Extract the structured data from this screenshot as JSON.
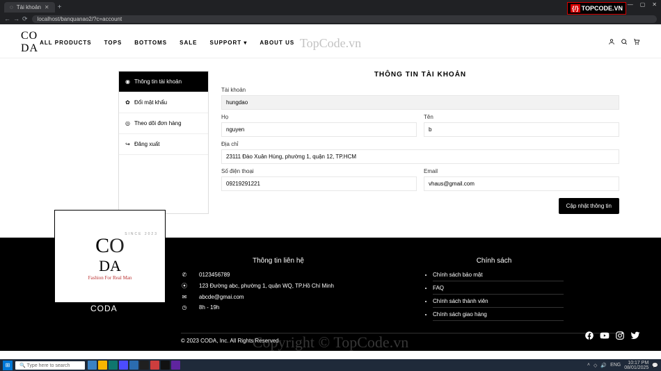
{
  "browser": {
    "tab_title": "Tài khoản",
    "url": "localhost/banquanao2/?c=account",
    "win_min": "—",
    "win_max": "▢",
    "win_close": "✕"
  },
  "watermarks": {
    "topcode": "TOPCODE.VN",
    "center": "TopCode.vn",
    "footer_wm": "Copyright © TopCode.vn"
  },
  "header": {
    "logo": "CODA",
    "nav": {
      "all": "ALL PRODUCTS",
      "tops": "TOPS",
      "bottoms": "BOTTOMS",
      "sale": "SALE",
      "support": "SUPPORT",
      "about": "ABOUT US"
    }
  },
  "sidebar": {
    "account_info": "Thông tin tài khoản",
    "change_pw": "Đổi mật khẩu",
    "orders": "Theo dõi đơn hàng",
    "logout": "Đăng xuất"
  },
  "panel": {
    "title": "THÔNG TIN TÀI KHOẢN",
    "labels": {
      "username": "Tài khoản",
      "lastname": "Họ",
      "firstname": "Tên",
      "address": "Địa chỉ",
      "phone": "Số điện thoại",
      "email": "Email"
    },
    "values": {
      "username": "hungdao",
      "lastname": "nguyen",
      "firstname": "b",
      "address": "23111 Đào Xuân Hùng, phường 1, quận 12, TP.HCM",
      "phone": "09219291221",
      "email": "vhaus@gmail.com"
    },
    "submit": "Cập nhật thông tin"
  },
  "footer": {
    "brand": "CODA",
    "card_tag": "Fashion For Real Man",
    "since_badge": "SINCE 2023",
    "contact_title": "Thông tin liên hệ",
    "contact": {
      "phone": "0123456789",
      "address": "123 Đường abc, phường 1, quận WQ, TP.Hồ Chí Minh",
      "email": "abcde@gmai.com",
      "hours": "8h - 19h"
    },
    "policy_title": "Chính sách",
    "policies": [
      "Chính sách bảo mật",
      "FAQ",
      "Chính sách thành viên",
      "Chính sách giao hàng"
    ],
    "copyright": "© 2023 CODA, Inc. All Rights Reserved"
  },
  "taskbar": {
    "search_ph": "Type here to search",
    "time": "10:17 PM",
    "date": "08/01/2025"
  }
}
